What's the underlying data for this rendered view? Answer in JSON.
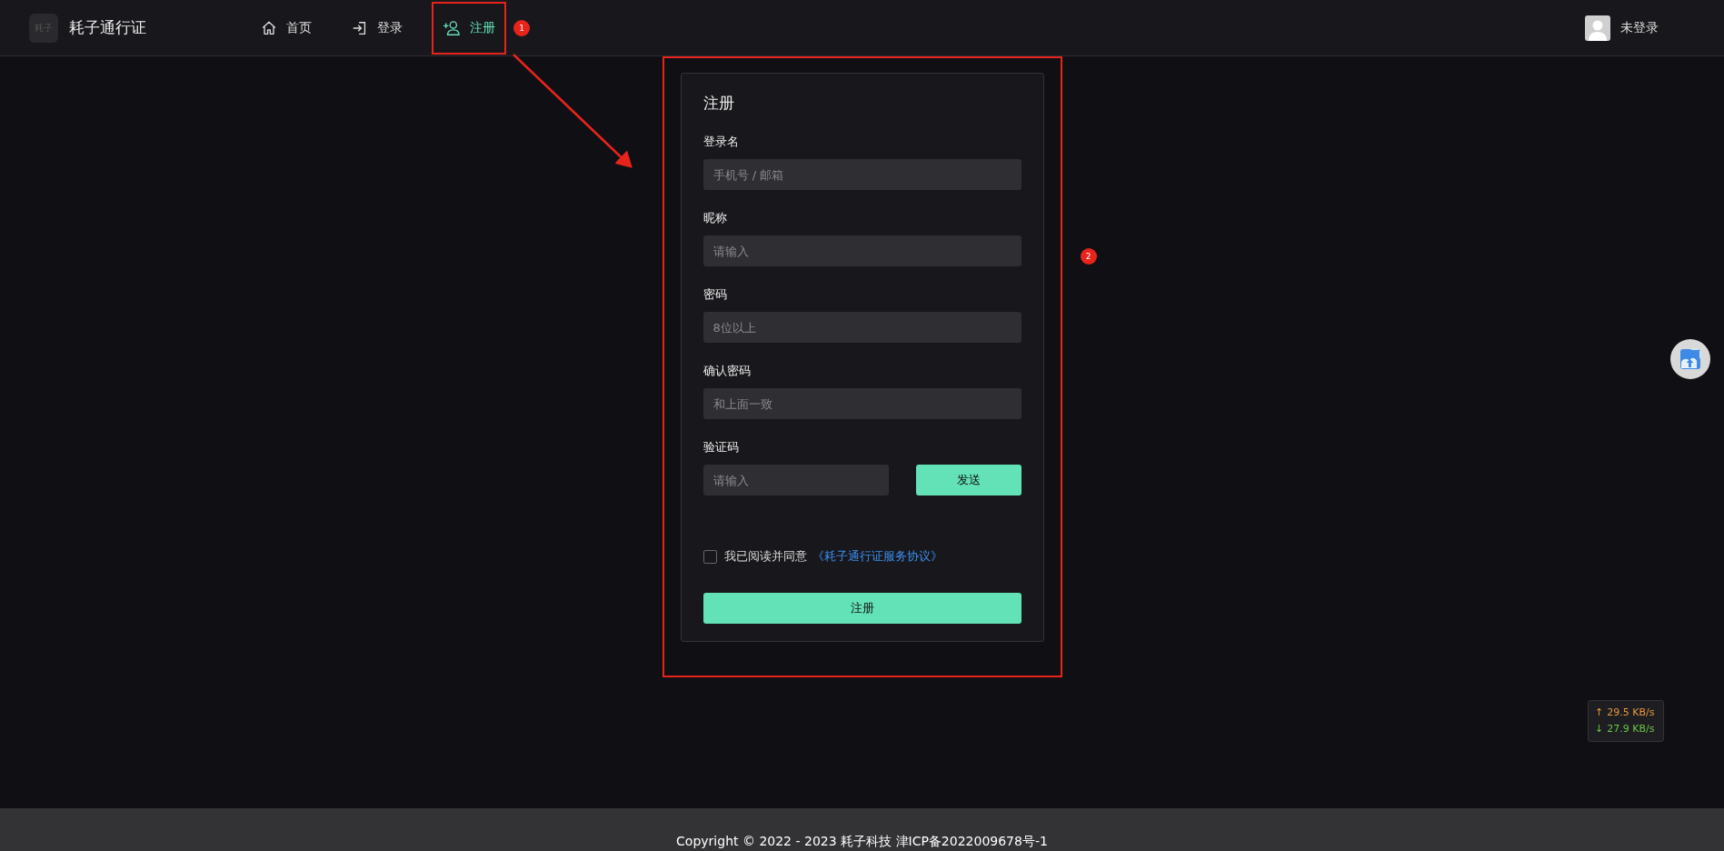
{
  "header": {
    "logo_text": "耗子",
    "title": "耗子通行证",
    "nav": [
      {
        "label": "首页",
        "selected": false
      },
      {
        "label": "登录",
        "selected": false
      },
      {
        "label": "注册",
        "selected": true
      }
    ],
    "user": {
      "label": "未登录"
    }
  },
  "annotations": [
    {
      "label": "1"
    },
    {
      "label": "2"
    }
  ],
  "form": {
    "title": "注册",
    "fields": [
      {
        "kind": "text",
        "label": "登录名",
        "placeholder": "手机号 / 邮箱"
      },
      {
        "kind": "text",
        "label": "昵称",
        "placeholder": "请输入"
      },
      {
        "kind": "text",
        "label": "密码",
        "placeholder": "8位以上"
      },
      {
        "kind": "text",
        "label": "确认密码",
        "placeholder": "和上面一致"
      },
      {
        "kind": "code",
        "label": "验证码",
        "placeholder": "请输入",
        "button": "发送"
      }
    ],
    "agreement": {
      "checked": false,
      "text": "我已阅读并同意",
      "link": "《耗子通行证服务协议》"
    },
    "submit": "注册"
  },
  "net_speed": [
    {
      "arrow": "↑",
      "rate": "29.5 KB/s",
      "color": "#e8993a"
    },
    {
      "arrow": "↓",
      "rate": "27.9 KB/s",
      "color": "#6cc644"
    }
  ],
  "footer": {
    "text": "Copyright © 2022 - 2023 耗子科技 津ICP备2022009678号-1"
  }
}
